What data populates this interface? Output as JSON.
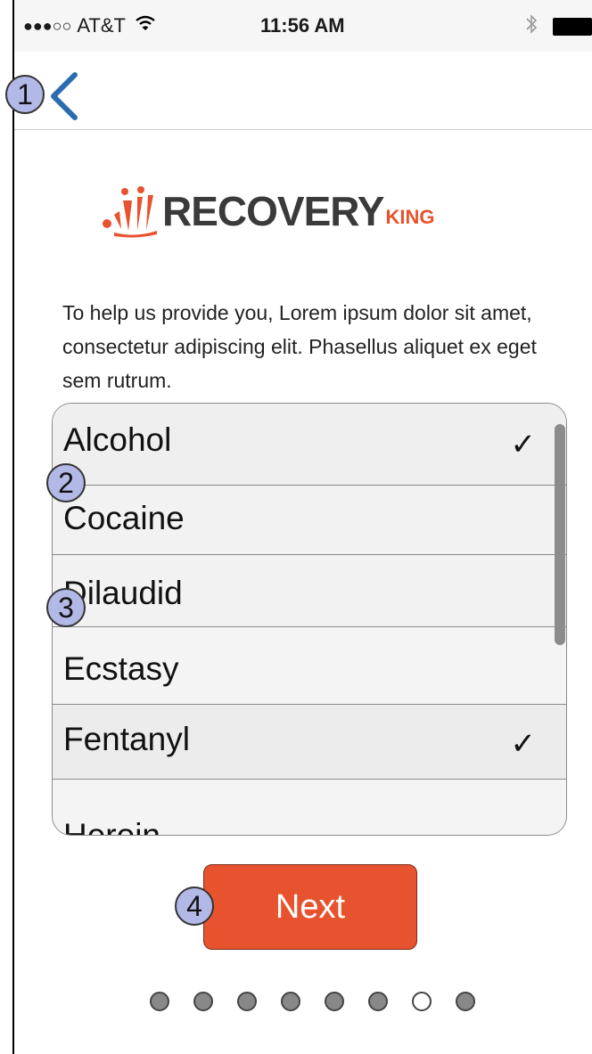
{
  "status_bar": {
    "signal": "●●●○○",
    "carrier": "AT&T",
    "wifi_icon": "wifi-icon",
    "time": "11:56 AM",
    "bluetooth_icon": "bluetooth-icon"
  },
  "nav": {
    "back_icon": "chevron-left-icon"
  },
  "callouts": [
    "1",
    "2",
    "3",
    "4"
  ],
  "logo": {
    "main": "RECOVERY",
    "sub": "KING"
  },
  "intro": "To help us provide you,  Lorem ipsum dolor sit amet, consectetur adipiscing elit. Phasellus aliquet ex eget sem rutrum.",
  "list": {
    "items": [
      {
        "label": "Alcohol",
        "checked": true
      },
      {
        "label": "Cocaine",
        "checked": false
      },
      {
        "label": "Dilaudid",
        "checked": false
      },
      {
        "label": "Ecstasy",
        "checked": false
      },
      {
        "label": "Fentanyl",
        "checked": true
      },
      {
        "label": "Heroin",
        "checked": false
      }
    ],
    "check_mark": "✓"
  },
  "next_button": {
    "label": "Next"
  },
  "pager": {
    "total": 8,
    "current": 7
  },
  "colors": {
    "accent": "#e8532f",
    "callout": "#b3b9e6",
    "back": "#2b6cb0"
  }
}
